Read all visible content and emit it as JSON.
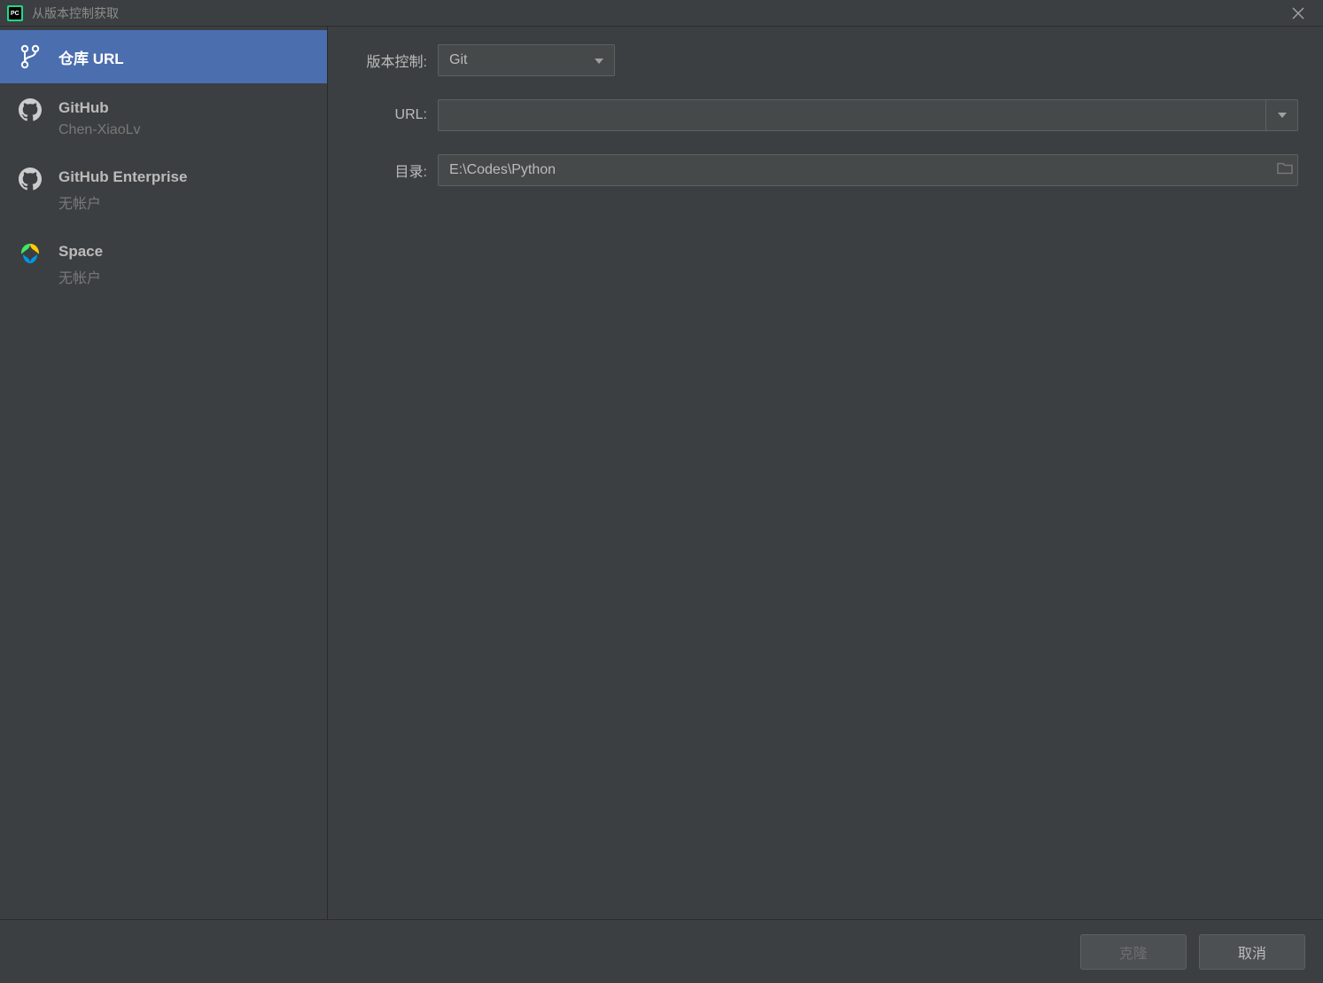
{
  "window": {
    "title": "从版本控制获取"
  },
  "sidebar": {
    "items": [
      {
        "label": "仓库 URL",
        "sub": "",
        "icon": "branch-icon",
        "selected": true
      },
      {
        "label": "GitHub",
        "sub": "Chen-XiaoLv",
        "icon": "github-icon",
        "selected": false
      },
      {
        "label": "GitHub Enterprise",
        "sub": "无帐户",
        "icon": "github-icon",
        "selected": false
      },
      {
        "label": "Space",
        "sub": "无帐户",
        "icon": "space-icon",
        "selected": false
      }
    ]
  },
  "form": {
    "vcs_label": "版本控制:",
    "vcs_value": "Git",
    "url_label": "URL:",
    "url_value": "",
    "dir_label": "目录:",
    "dir_value": "E:\\Codes\\Python"
  },
  "footer": {
    "clone_label": "克隆",
    "cancel_label": "取消"
  }
}
